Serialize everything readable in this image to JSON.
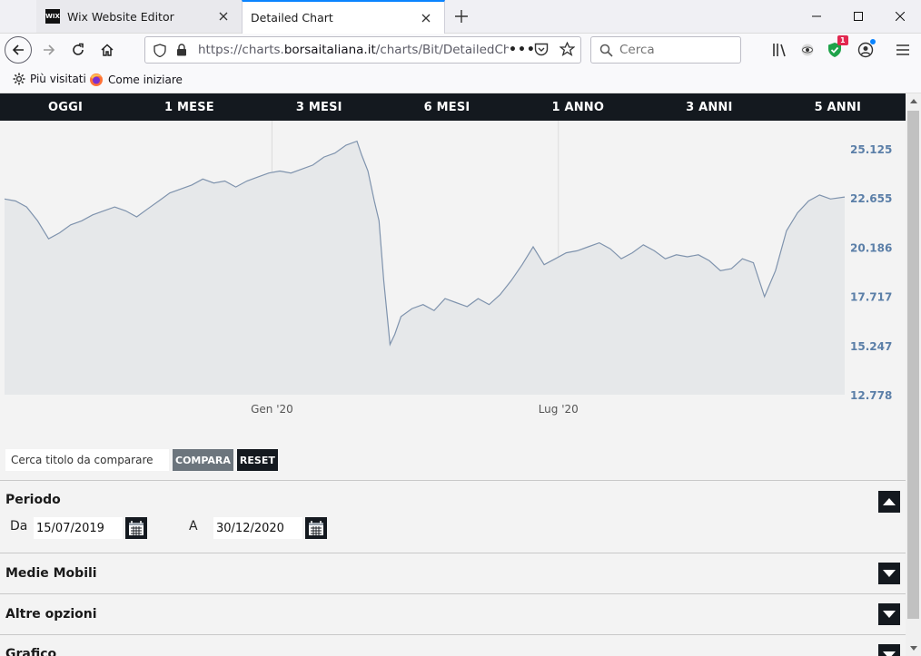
{
  "browser": {
    "tabs": [
      {
        "label": "Wix Website Editor",
        "favicon": "WIX"
      },
      {
        "label": "Detailed Chart"
      }
    ],
    "url": {
      "prefix": "https://charts.",
      "host": "borsaitaliana.it",
      "path": "/charts/Bit/DetailedChart.a"
    },
    "search_placeholder": "Cerca",
    "notification_badge": "1",
    "bookmarks": [
      {
        "label": "Più visitati",
        "icon": "gear-icon"
      },
      {
        "label": "Come iniziare",
        "icon": "firefox-icon"
      }
    ]
  },
  "periods": [
    "OGGI",
    "1 MESE",
    "3 MESI",
    "6 MESI",
    "1 ANNO",
    "3 ANNI",
    "5 ANNI"
  ],
  "compare": {
    "placeholder": "Cerca titolo da comparare",
    "compare_label": "COMPARA",
    "reset_label": "RESET"
  },
  "sections": {
    "periodo": {
      "title": "Periodo",
      "from_label": "Da",
      "from_value": "15/07/2019",
      "to_label": "A",
      "to_value": "30/12/2020"
    },
    "medie_mobili": {
      "title": "Medie Mobili"
    },
    "altre_opzioni": {
      "title": "Altre opzioni"
    },
    "grafico": {
      "title": "Grafico"
    }
  },
  "colors": {
    "accent_dark": "#14191f",
    "line": "#7f93ad",
    "area": "#e6e8ea",
    "axis_label": "#5b7fa8"
  },
  "chart_data": {
    "type": "area",
    "title": "",
    "xlabel": "",
    "ylabel": "",
    "ylim": [
      12.778,
      26.3
    ],
    "ytick_labels": [
      "25.125",
      "22.655",
      "20.186",
      "17.717",
      "15.247",
      "12.778"
    ],
    "yticks": [
      25.125,
      22.655,
      20.186,
      17.717,
      15.247,
      12.778
    ],
    "xticks": [
      {
        "label": "Gen '20",
        "date": "2020-01-01"
      },
      {
        "label": "Lug '20",
        "date": "2020-07-01"
      }
    ],
    "grid": true,
    "series": [
      {
        "x": [
          "2019-07-15",
          "2019-07-22",
          "2019-07-29",
          "2019-08-05",
          "2019-08-12",
          "2019-08-19",
          "2019-08-26",
          "2019-09-02",
          "2019-09-09",
          "2019-09-16",
          "2019-09-23",
          "2019-09-30",
          "2019-10-07",
          "2019-10-14",
          "2019-10-21",
          "2019-10-28",
          "2019-11-04",
          "2019-11-11",
          "2019-11-18",
          "2019-11-25",
          "2019-12-02",
          "2019-12-09",
          "2019-12-16",
          "2019-12-23",
          "2019-12-30",
          "2020-01-06",
          "2020-01-13",
          "2020-01-20",
          "2020-01-27",
          "2020-02-03",
          "2020-02-10",
          "2020-02-17",
          "2020-02-24",
          "2020-02-27",
          "2020-03-02",
          "2020-03-06",
          "2020-03-09",
          "2020-03-12",
          "2020-03-16",
          "2020-03-19",
          "2020-03-23",
          "2020-03-30",
          "2020-04-06",
          "2020-04-13",
          "2020-04-20",
          "2020-04-27",
          "2020-05-04",
          "2020-05-11",
          "2020-05-18",
          "2020-05-25",
          "2020-06-01",
          "2020-06-08",
          "2020-06-15",
          "2020-06-22",
          "2020-06-29",
          "2020-07-06",
          "2020-07-13",
          "2020-07-20",
          "2020-07-27",
          "2020-08-03",
          "2020-08-10",
          "2020-08-17",
          "2020-08-24",
          "2020-08-31",
          "2020-09-07",
          "2020-09-14",
          "2020-09-21",
          "2020-09-28",
          "2020-10-05",
          "2020-10-12",
          "2020-10-19",
          "2020-10-26",
          "2020-11-02",
          "2020-11-09",
          "2020-11-16",
          "2020-11-23",
          "2020-11-30",
          "2020-12-07",
          "2020-12-14",
          "2020-12-21",
          "2020-12-30"
        ],
        "values": [
          22.6,
          22.5,
          22.2,
          21.5,
          20.6,
          20.9,
          21.3,
          21.5,
          21.8,
          22.0,
          22.2,
          22.0,
          21.7,
          22.1,
          22.5,
          22.9,
          23.1,
          23.3,
          23.6,
          23.4,
          23.5,
          23.2,
          23.5,
          23.7,
          23.9,
          24.0,
          23.9,
          24.1,
          24.3,
          24.7,
          24.9,
          25.3,
          25.5,
          24.8,
          24.0,
          22.5,
          21.5,
          18.5,
          15.3,
          15.8,
          16.7,
          17.1,
          17.3,
          17.0,
          17.6,
          17.4,
          17.2,
          17.6,
          17.3,
          17.8,
          18.5,
          19.3,
          20.2,
          19.3,
          19.6,
          19.9,
          20.0,
          20.2,
          20.4,
          20.1,
          19.6,
          19.9,
          20.3,
          20.0,
          19.6,
          19.8,
          19.7,
          19.8,
          19.5,
          19.0,
          19.1,
          19.6,
          19.4,
          17.7,
          19.0,
          21.0,
          21.9,
          22.5,
          22.8,
          22.6,
          22.7
        ]
      }
    ]
  }
}
